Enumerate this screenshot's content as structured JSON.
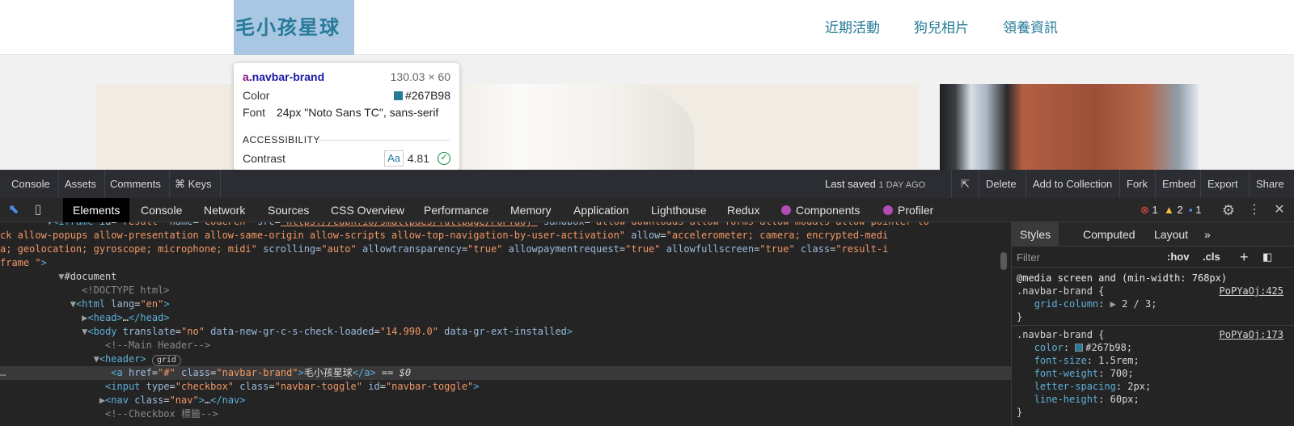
{
  "site": {
    "brand": "毛小孩星球",
    "nav": [
      "近期活動",
      "狗兒相片",
      "領養資訊"
    ]
  },
  "tooltip": {
    "tag": "a",
    "cls": ".navbar-brand",
    "size": "130.03 × 60",
    "color_label": "Color",
    "color_value": "#267B98",
    "font_label": "Font",
    "font_value": "24px \"Noto Sans TC\", sans-serif",
    "accessibility": "ACCESSIBILITY",
    "contrast_label": "Contrast",
    "contrast_sample": "Aa",
    "contrast_value": "4.81"
  },
  "codepen_bar": {
    "left_buttons": [
      "Console",
      "Assets",
      "Comments",
      "⌘ Keys"
    ],
    "last_saved": "Last saved",
    "last_saved_when": "1 DAY AGO",
    "right_buttons": [
      "Delete",
      "Add to Collection",
      "Fork",
      "Embed",
      "Export",
      "Share"
    ]
  },
  "devtools": {
    "tabs": [
      "Elements",
      "Console",
      "Network",
      "Sources",
      "CSS Overview",
      "Performance",
      "Memory",
      "Application",
      "Lighthouse",
      "Redux",
      "Components",
      "Profiler"
    ],
    "errors": "1",
    "warnings": "2",
    "infos": "1"
  },
  "styles_pane": {
    "tabs": [
      "Styles",
      "Computed",
      "Layout",
      "»"
    ],
    "filter_placeholder": "Filter",
    "hov": ":hov",
    "cls": ".cls",
    "rules": [
      {
        "media": "@media screen and (min-width: 768px)",
        "selector": ".navbar-brand {",
        "source": "PoPYaOj:425",
        "decls": [
          [
            "grid-column",
            "2 / 3"
          ]
        ]
      },
      {
        "selector": ".navbar-brand {",
        "source": "PoPYaOj:173",
        "decls": [
          [
            "color",
            "#267b98"
          ],
          [
            "font-size",
            "1.5rem"
          ],
          [
            "font-weight",
            "700"
          ],
          [
            "letter-spacing",
            "2px"
          ],
          [
            "line-height",
            "60px"
          ]
        ]
      }
    ]
  },
  "colors": {
    "brand": "#267b98",
    "highlight": "#a9c6e3"
  }
}
